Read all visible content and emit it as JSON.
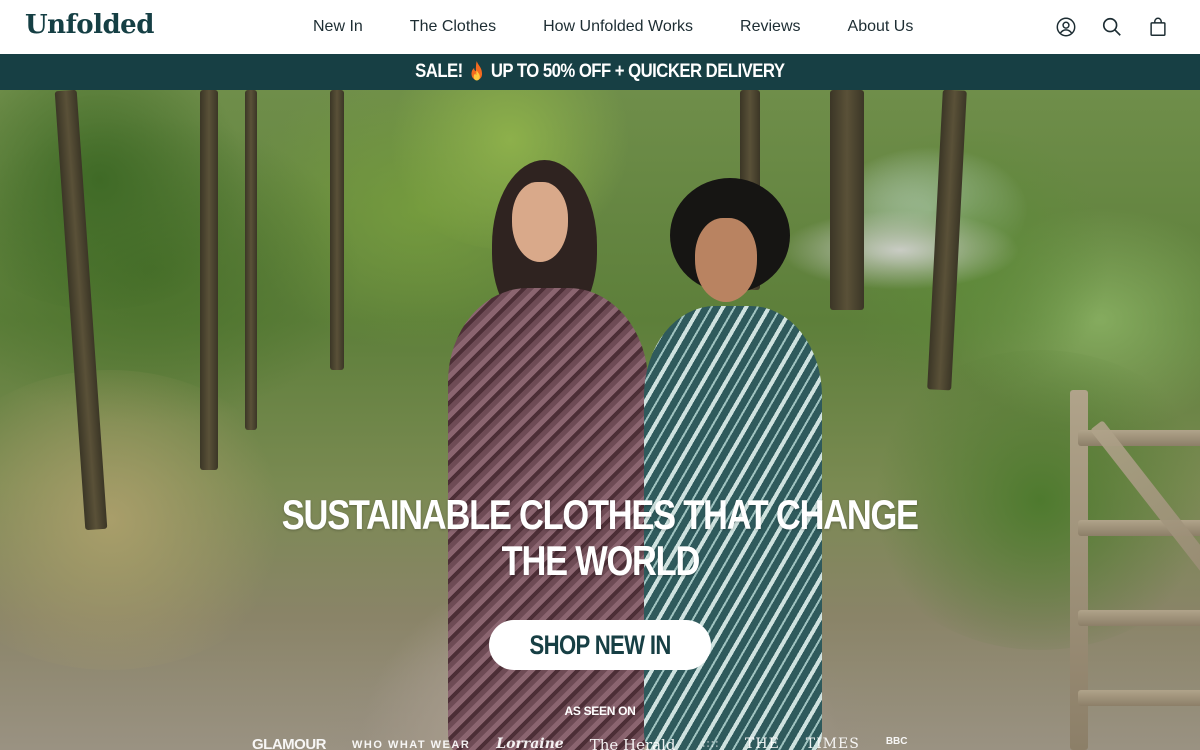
{
  "header": {
    "logo": "Unfolded",
    "nav": [
      "New In",
      "The Clothes",
      "How Unfolded Works",
      "Reviews",
      "About Us"
    ],
    "icons": [
      "account-icon",
      "search-icon",
      "shopping-bag-icon"
    ]
  },
  "promo": {
    "before": "SALE!",
    "icon": "fire-icon",
    "after": "UP TO 50% OFF + QUICKER DELIVERY"
  },
  "hero": {
    "title_line1": "SUSTAINABLE CLOTHES THAT CHANGE",
    "title_line2": "THE WORLD",
    "cta": "SHOP NEW IN",
    "as_seen_on": "AS SEEN ON",
    "press": [
      "GLAMOUR",
      "WHO WHAT WEAR",
      "Lorraine",
      "The Herald",
      "::::",
      "THE",
      "TIMES",
      "BBC"
    ]
  },
  "colors": {
    "brand": "#173f44",
    "white": "#ffffff",
    "nav_text": "#1d2d33"
  }
}
